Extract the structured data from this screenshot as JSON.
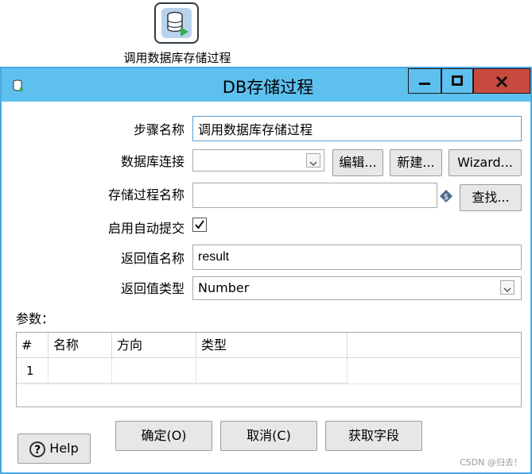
{
  "canvas": {
    "step_label": "调用数据库存储过程"
  },
  "window": {
    "title": "DB存储过程",
    "controls": {
      "minimize": "—",
      "maximize": "□",
      "close": "X"
    }
  },
  "form": {
    "step_name_label": "步骤名称",
    "step_name_value": "调用数据库存储过程",
    "db_connection_label": "数据库连接",
    "db_connection_value": "",
    "edit_button": "编辑...",
    "new_button": "新建...",
    "wizard_button": "Wizard...",
    "proc_name_label": "存储过程名称",
    "proc_name_value": "",
    "find_button": "查找...",
    "auto_commit_label": "启用自动提交",
    "auto_commit_checked": true,
    "return_name_label": "返回值名称",
    "return_name_value": "result",
    "return_type_label": "返回值类型",
    "return_type_value": "Number"
  },
  "params": {
    "label": "参数：",
    "columns": [
      "#",
      "名称",
      "方向",
      "类型"
    ],
    "rows": [
      {
        "index": "1",
        "name": "",
        "direction": "",
        "type": ""
      }
    ]
  },
  "buttons": {
    "help": "Help",
    "ok": "确定(O)",
    "cancel": "取消(C)",
    "get_fields": "获取字段"
  },
  "watermark": "CSDN @归去！",
  "colors": {
    "titlebar": "#5ec0ee",
    "close": "#c84a3e",
    "border": "#4aa7e2"
  }
}
